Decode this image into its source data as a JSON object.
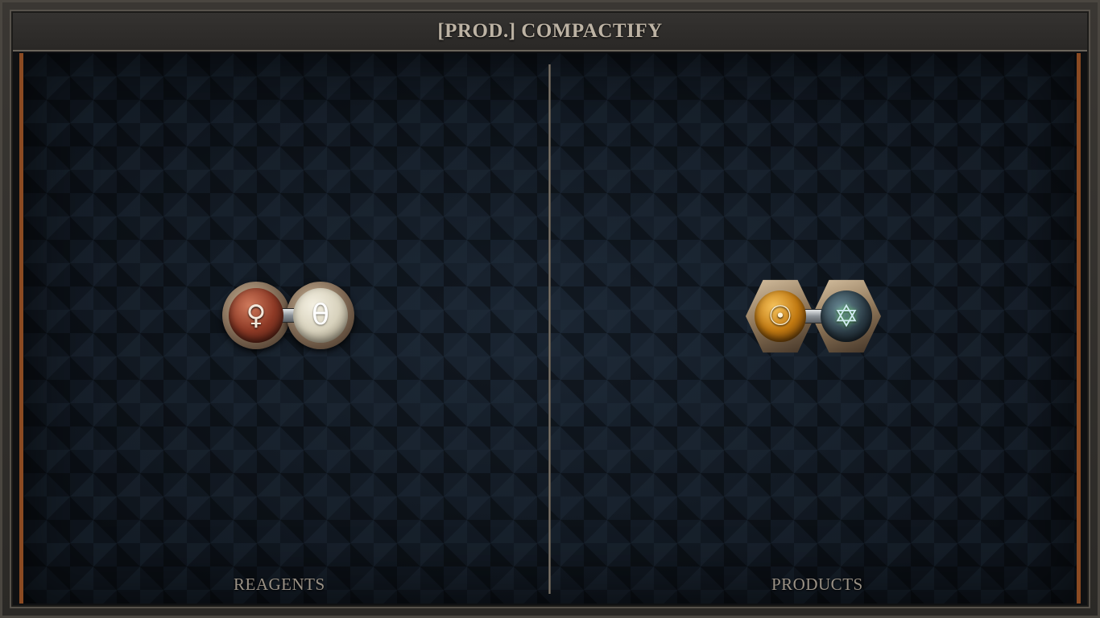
{
  "header": {
    "title": "[PROD.] COMPACTIFY"
  },
  "panels": {
    "reagents": {
      "label": "REAGENTS",
      "molecule": {
        "atoms": [
          {
            "element": "copper",
            "symbol": "♀",
            "color": "#8e3a26"
          },
          {
            "element": "salt",
            "symbol": "θ",
            "color": "#d8d2bd"
          }
        ],
        "bond": "normal"
      }
    },
    "products": {
      "label": "PRODUCTS",
      "molecule": {
        "atoms": [
          {
            "element": "gold",
            "symbol": "☉",
            "color": "#c27a12"
          },
          {
            "element": "quintessence",
            "symbol": "✡",
            "color": "#4a6a78"
          }
        ],
        "bond": "normal"
      }
    }
  },
  "colors": {
    "accent_rail": "#8a4a22",
    "title_text": "#bdb3a4",
    "label_text": "#9b9286"
  }
}
